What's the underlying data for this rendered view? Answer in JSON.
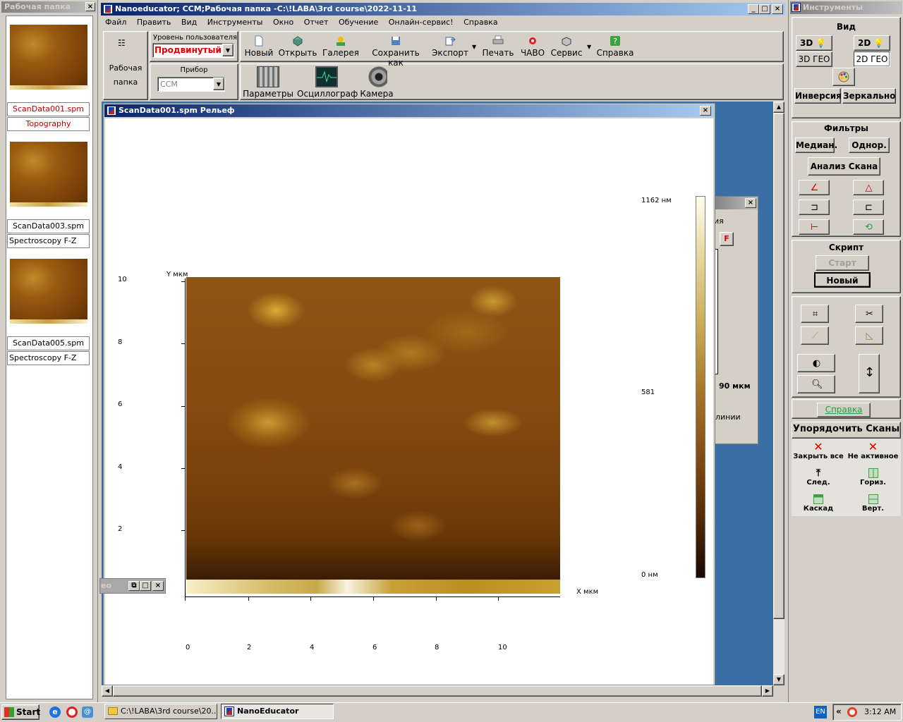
{
  "left_panel": {
    "title": "Рабочая папка",
    "files": [
      {
        "name": "ScanData001.spm",
        "type": "Topography",
        "active": true
      },
      {
        "name": "ScanData003.spm",
        "type": "Spectroscopy F-Z",
        "active": false
      },
      {
        "name": "ScanData005.spm",
        "type": "Spectroscopy F-Z",
        "active": false
      }
    ]
  },
  "main_window": {
    "title": "Nanoeducator; CCM;Рабочая папка -C:\\!LABA\\3rd course\\2022-11-11",
    "menu": [
      "Файл",
      "Править",
      "Вид",
      "Инструменты",
      "Окно",
      "Отчет",
      "Обучение",
      "Онлайн-сервис!",
      "Справка"
    ]
  },
  "toolbar": {
    "workfolder_line1": "Рабочая",
    "workfolder_line2": "папка",
    "user_level_label": "Уровень пользователя",
    "user_level_value": "Продвинутый",
    "device_label": "Прибор",
    "device_value": "CCM",
    "buttons_row1": [
      "Новый",
      "Открыть",
      "Галерея",
      "Сохранить как",
      "Экспорт",
      "Печать",
      "ЧАВО",
      "Сервис",
      "Справка"
    ],
    "buttons_row2": [
      "Параметры",
      "Осциллограф",
      "Камера"
    ]
  },
  "scan_window": {
    "title": "ScanData001.spm  Рельеф",
    "y_label": "Y мкм",
    "x_label": "X мкм",
    "y_ticks": [
      "10",
      "8",
      "6",
      "4",
      "2"
    ],
    "x_ticks": [
      "0",
      "2",
      "4",
      "6",
      "8",
      "10"
    ],
    "scale_max": "1162 нм",
    "scale_mid": "581",
    "scale_min": "0 нм"
  },
  "background_window": {
    "frag1": "ия",
    "frag2": "F",
    "frag3": "90 мкм",
    "frag4": "линии",
    "minimized_label": "ео"
  },
  "right_panel": {
    "title": "Инструменты",
    "view_header": "Вид",
    "view_buttons": [
      "3D",
      "2D",
      "3D ГЕО",
      "2D ГЕО"
    ],
    "inversion": "Инверсия",
    "mirror": "Зеркально",
    "filters_header": "Фильтры",
    "median": "Медиан.",
    "uniform": "Однор.",
    "scan_analysis": "Анализ Скана",
    "script_header": "Скрипт",
    "script_start": "Старт",
    "script_new": "Новый",
    "help": "Справка",
    "arrange_header": "Упорядочить Сканы",
    "arrange_items": [
      "Закрыть все",
      "Не активное",
      "След.",
      "Гориз.",
      "Каскад",
      "Верт."
    ]
  },
  "taskbar": {
    "start": "Start",
    "tasks": [
      "C:\\!LABA\\3rd course\\20...",
      "NanoEducator"
    ],
    "lang": "EN",
    "time": "3:12 AM"
  }
}
